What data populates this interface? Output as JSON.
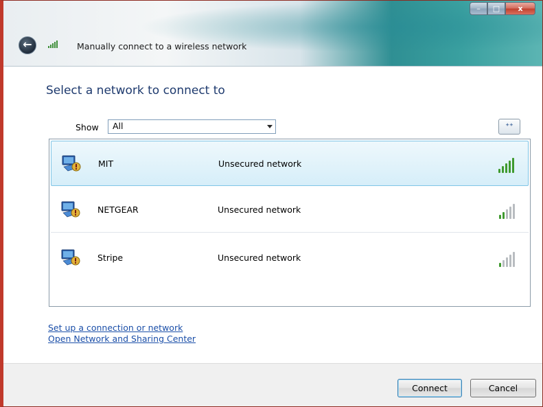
{
  "window": {
    "title": "Manually connect to a wireless network",
    "controls": {
      "minimize": "–",
      "maximize": "□",
      "close": "x"
    }
  },
  "icons": {
    "back": "back-arrow-icon",
    "title_signal": "signal-strength-icon",
    "refresh": "refresh-icon",
    "network": "wireless-network-icon"
  },
  "glyphs": {
    "back": "←",
    "refresh": "⁺⁺"
  },
  "heading": "Select a network to connect to",
  "filter": {
    "label": "Show",
    "value": "All"
  },
  "networks": [
    {
      "name": "MIT",
      "status": "Unsecured network",
      "signal_bars": 5,
      "selected": true
    },
    {
      "name": "NETGEAR",
      "status": "Unsecured network",
      "signal_bars": 2,
      "selected": false
    },
    {
      "name": "Stripe",
      "status": "Unsecured network",
      "signal_bars": 1,
      "selected": false
    }
  ],
  "links": {
    "setup": "Set up a connection or network",
    "sharing_center": "Open Network and Sharing Center"
  },
  "buttons": {
    "connect": "Connect",
    "cancel": "Cancel"
  },
  "colors": {
    "signal_active": "#3f9a2f",
    "signal_inactive": "#b8bcc0",
    "heading": "#1e3a6e",
    "link": "#1a4ea8"
  }
}
